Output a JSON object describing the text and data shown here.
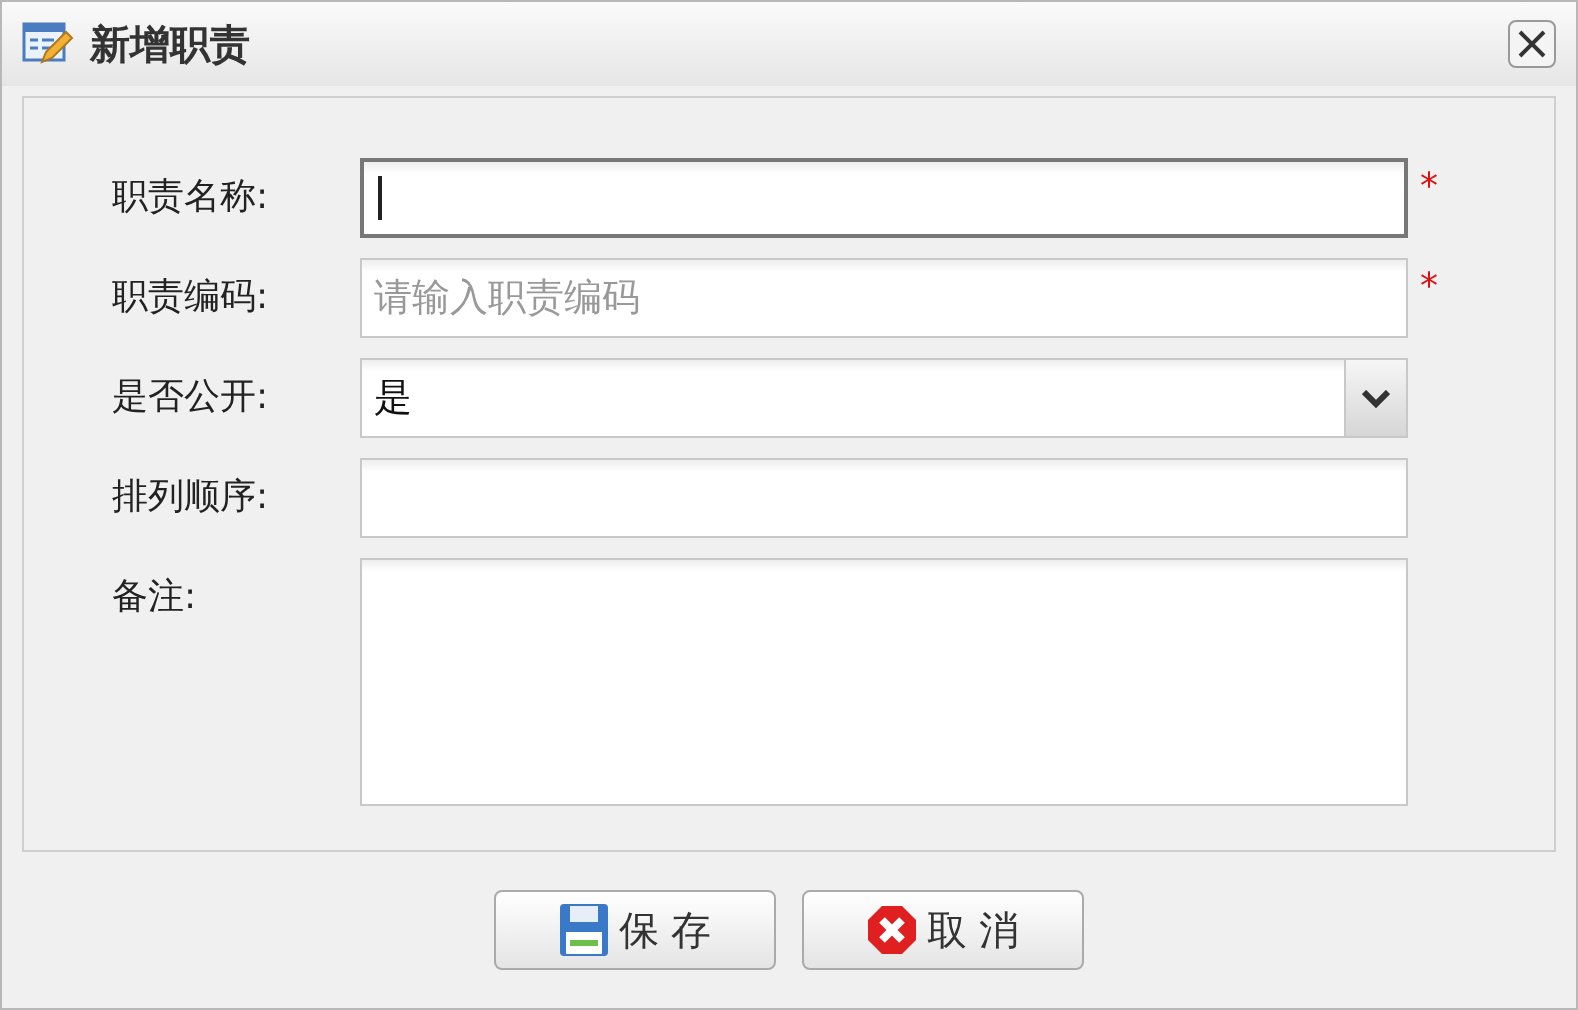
{
  "window": {
    "title": "新增职责"
  },
  "fields": [
    {
      "kind": "text",
      "label": "职责名称:",
      "focused": true,
      "required": "*"
    },
    {
      "kind": "text",
      "label": "职责编码:",
      "placeholder": "请输入职责编码",
      "focused": false,
      "required": "*"
    },
    {
      "kind": "select",
      "label": "是否公开:",
      "value": "是",
      "focused": false
    },
    {
      "kind": "text",
      "label": "排列顺序:",
      "focused": false
    },
    {
      "kind": "textarea",
      "label": "备注:",
      "focused": false
    }
  ],
  "buttons": [
    {
      "kind": "save",
      "label": "保 存"
    },
    {
      "kind": "cancel",
      "label": "取 消"
    }
  ]
}
